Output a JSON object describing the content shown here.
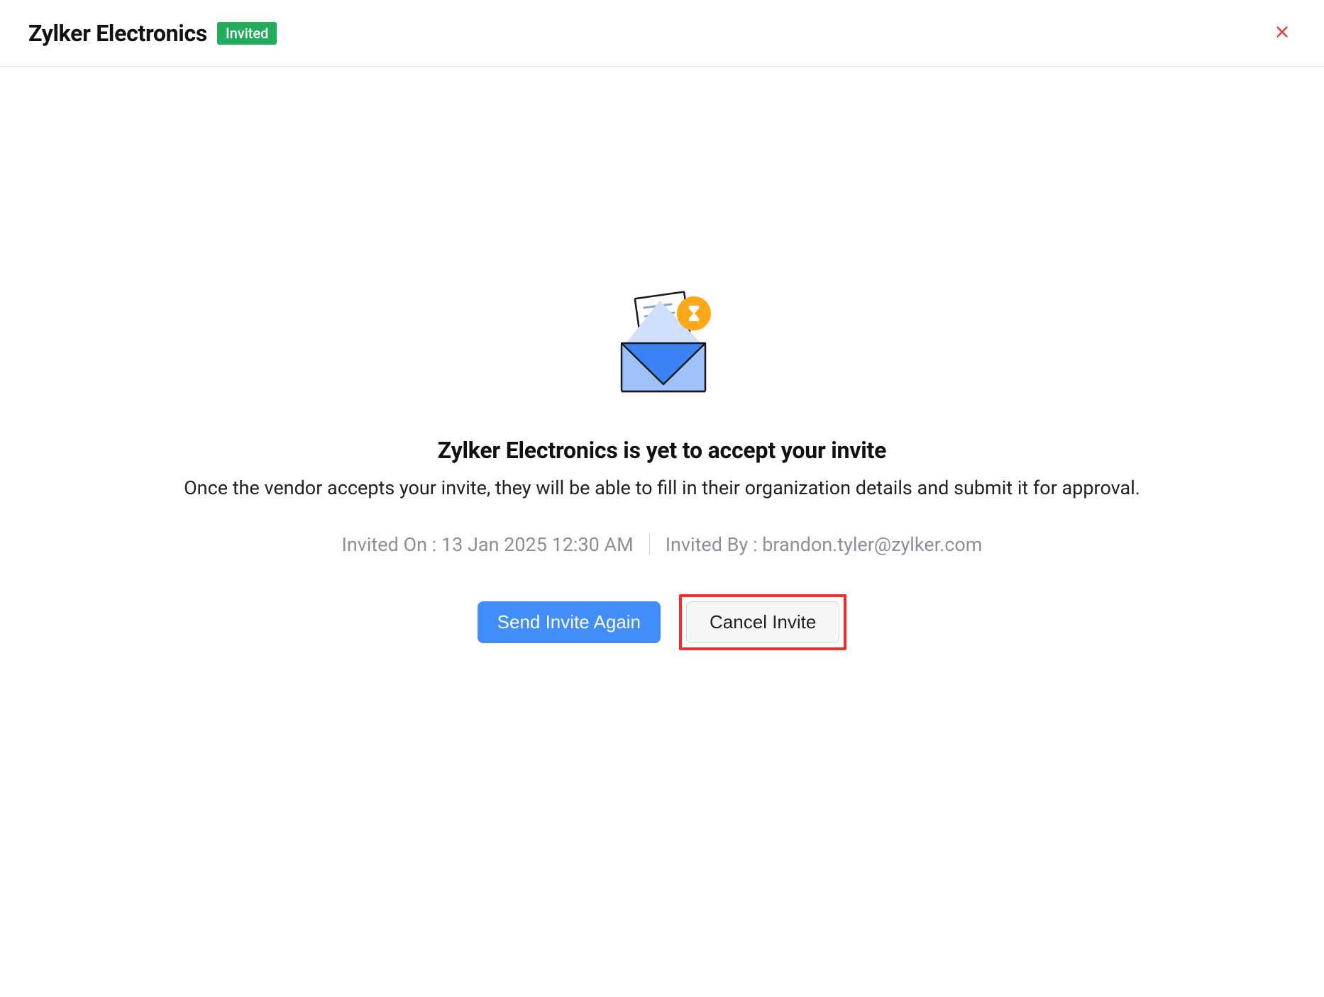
{
  "header": {
    "title": "Zylker Electronics",
    "status_badge": "Invited"
  },
  "content": {
    "headline": "Zylker Electronics is yet to accept your invite",
    "description": "Once the vendor accepts your invite, they will be able to fill in their organization details and submit it for approval.",
    "invited_on_label": "Invited On :",
    "invited_on_value": "13 Jan 2025 12:30 AM",
    "invited_by_label": "Invited By :",
    "invited_by_value": "brandon.tyler@zylker.com"
  },
  "actions": {
    "send_again_label": "Send Invite Again",
    "cancel_label": "Cancel Invite"
  }
}
